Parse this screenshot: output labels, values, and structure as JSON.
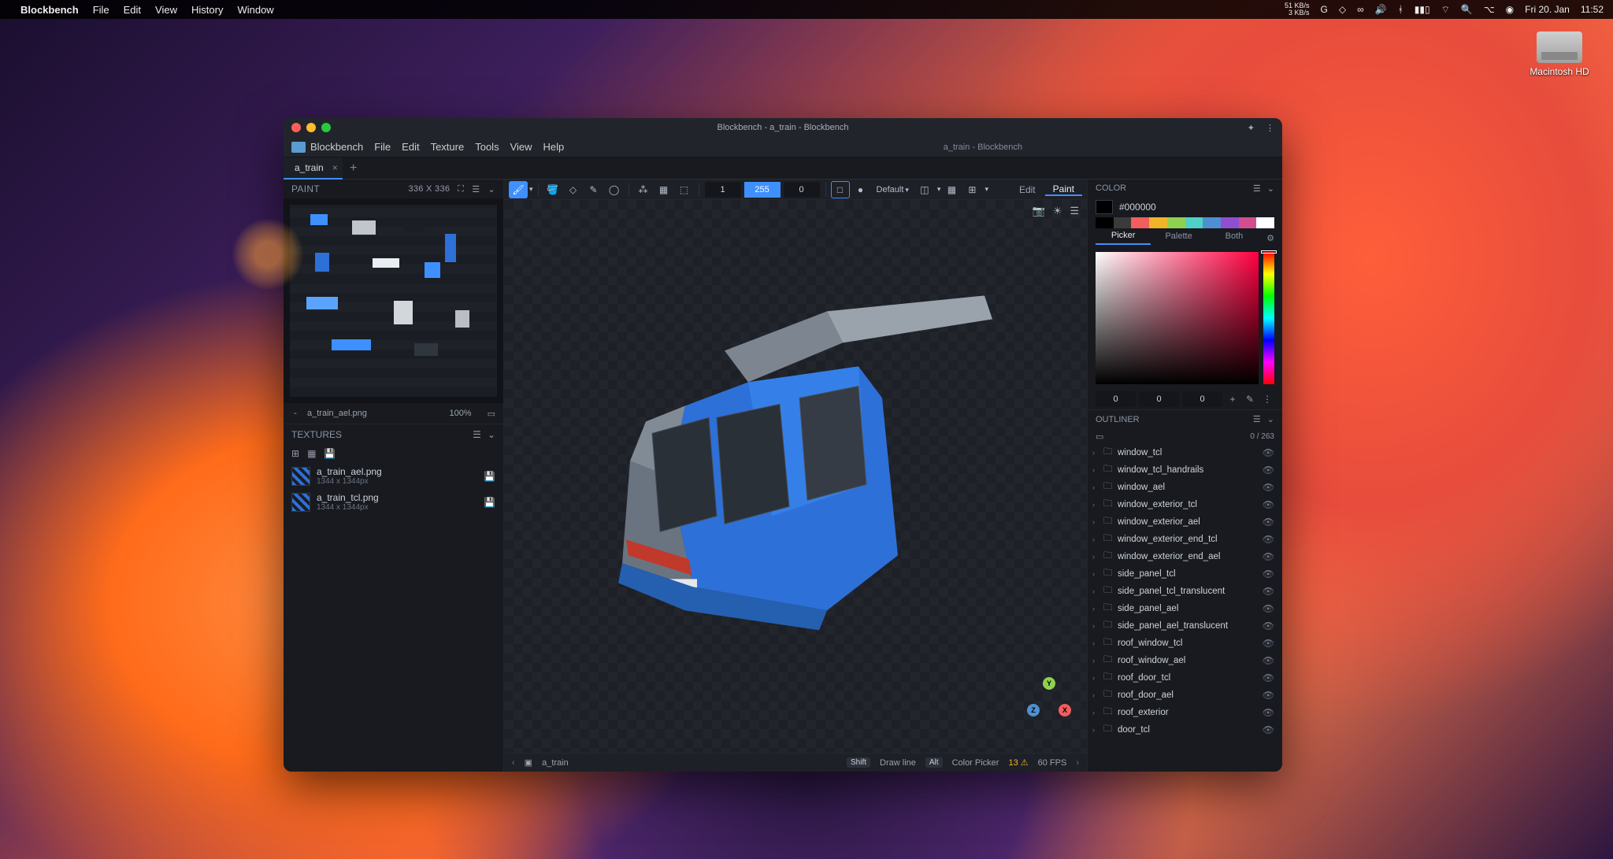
{
  "macmenu": {
    "app": "Blockbench",
    "items": [
      "File",
      "Edit",
      "View",
      "History",
      "Window"
    ],
    "net_up": "51 KB/s",
    "net_down": "3 KB/s",
    "date": "Fri 20. Jan",
    "time": "11:52"
  },
  "disk": {
    "label": "Macintosh HD"
  },
  "window": {
    "title": "Blockbench - a_train - Blockbench",
    "crumb": "a_train - Blockbench"
  },
  "appmenu": {
    "brand": "Blockbench",
    "items": [
      "File",
      "Edit",
      "Texture",
      "Tools",
      "View",
      "Help"
    ]
  },
  "tab": {
    "name": "a_train"
  },
  "paint": {
    "title": "PAINT",
    "dims": "336 X 336",
    "texture_file": "a_train_ael.png",
    "zoom": "100%"
  },
  "textures": {
    "title": "TEXTURES",
    "items": [
      {
        "name": "a_train_ael.png",
        "dim": "1344 x 1344px"
      },
      {
        "name": "a_train_tcl.png",
        "dim": "1344 x 1344px"
      }
    ]
  },
  "toolbar": {
    "n1": "1",
    "n2": "255",
    "n3": "0",
    "preset": "Default",
    "mode_edit": "Edit",
    "mode_paint": "Paint"
  },
  "status": {
    "model": "a_train",
    "shift_hint": "Draw line",
    "alt_hint": "Color Picker",
    "issues": "13",
    "fps": "60 FPS"
  },
  "color": {
    "title": "COLOR",
    "hex": "#000000",
    "tabs": {
      "picker": "Picker",
      "palette": "Palette",
      "both": "Both"
    },
    "r": "0",
    "g": "0",
    "b": "0"
  },
  "outliner": {
    "title": "OUTLINER",
    "count": "0 / 263",
    "items": [
      "window_tcl",
      "window_tcl_handrails",
      "window_ael",
      "window_exterior_tcl",
      "window_exterior_ael",
      "window_exterior_end_tcl",
      "window_exterior_end_ael",
      "side_panel_tcl",
      "side_panel_tcl_translucent",
      "side_panel_ael",
      "side_panel_ael_translucent",
      "roof_window_tcl",
      "roof_window_ael",
      "roof_door_tcl",
      "roof_door_ael",
      "roof_exterior",
      "door_tcl"
    ]
  }
}
